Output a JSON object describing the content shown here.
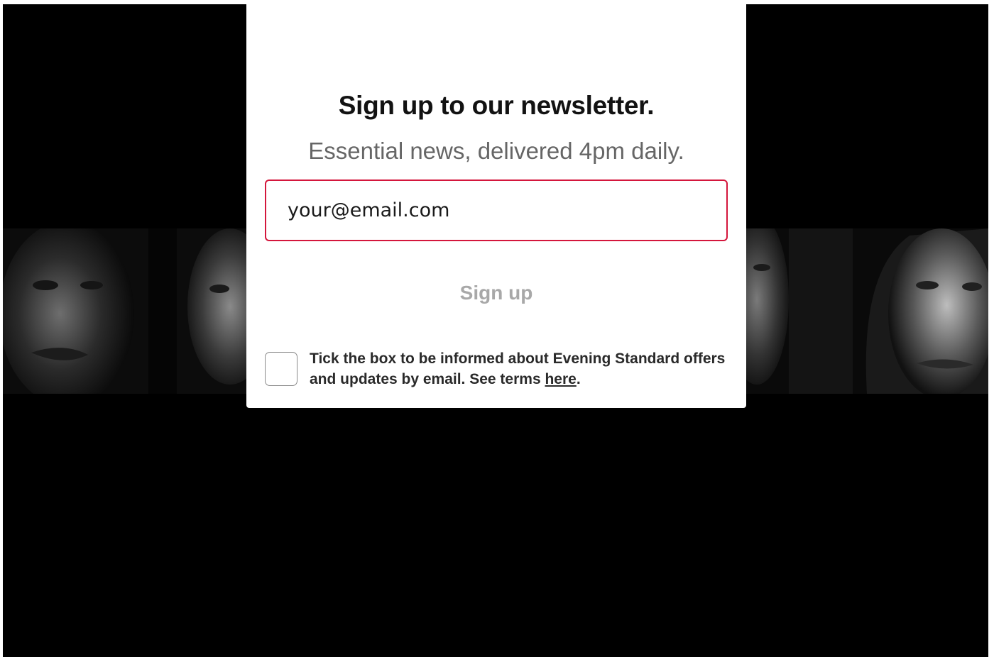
{
  "newsletter": {
    "title": "Sign up to our newsletter.",
    "subtitle": "Essential news, delivered 4pm daily.",
    "email_placeholder": "your@email.com",
    "submit_label": "Sign up",
    "consent_text_before": "Tick the box to be informed about Evening Standard offers and updates by email. See terms ",
    "consent_link": "here",
    "consent_text_after": "."
  },
  "colors": {
    "input_border": "#d4163c",
    "button_text_disabled": "#a8a8a8",
    "backdrop": "#000000"
  },
  "icons": {
    "checkbox": "empty-checkbox"
  }
}
